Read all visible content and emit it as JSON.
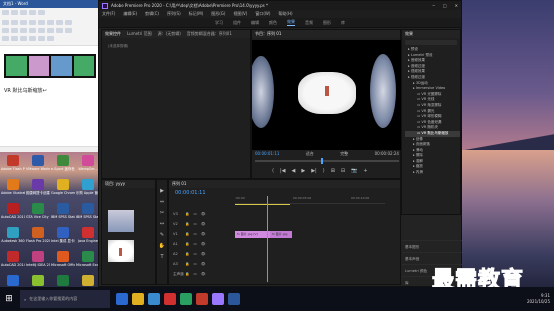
{
  "word": {
    "title": "文档1 - Word",
    "tabs": [
      "文件",
      "开始",
      "插入",
      "页面布局",
      "引用"
    ],
    "doc_text": "VR 默比乌斯缩放↩",
    "status": "第1页"
  },
  "desktop_icons": [
    {
      "label": "Adobe Flash Professio...",
      "color": "#c23a2a"
    },
    {
      "label": "VMware Workstati...",
      "color": "#2f5aa8"
    },
    {
      "label": "e-Sport 迷你世界",
      "color": "#3d8a3d"
    },
    {
      "label": "WampSer...",
      "color": "#d24a9a"
    },
    {
      "label": "Adobe Illustrat...",
      "color": "#e27a1a"
    },
    {
      "label": "韵唐网提卡创建 (v4.2...",
      "color": "#6a3aa8"
    },
    {
      "label": "Google Chrome",
      "color": "#e0b020"
    },
    {
      "label": "乐购 Apple 管理",
      "color": "#30a0d0"
    },
    {
      "label": "AutoCAD 2010",
      "color": "#b82020"
    },
    {
      "label": "GTA Vice City 2010",
      "color": "#2a8a4a"
    },
    {
      "label": "IBM SPSS Statistics 20",
      "color": "#2a5aa0"
    },
    {
      "label": "IBM SPSS Statistics 20",
      "color": "#2a5aa0"
    },
    {
      "label": "Autodesk 360",
      "color": "#30a0c0"
    },
    {
      "label": "Flash Pro 2020 3DS Max",
      "color": "#d06020"
    },
    {
      "label": "Intel 集成 显卡设置",
      "color": "#3060c0"
    },
    {
      "label": "Java Engine",
      "color": "#d03030"
    },
    {
      "label": "AutoCAD 2014",
      "color": "#c02a2a"
    },
    {
      "label": "IntelliJ IDEA 2016",
      "color": "#c04080"
    },
    {
      "label": "Microsoft Office",
      "color": "#e05a20"
    },
    {
      "label": "Microsoft Excel 2010",
      "color": "#2a8a4a"
    },
    {
      "label": "Azure RP 8",
      "color": "#2a6ad0"
    },
    {
      "label": "SVN版本控制",
      "color": "#8ac030"
    },
    {
      "label": "Microsoft Excel 2016",
      "color": "#1e7a3e"
    },
    {
      "label": "python 3.8",
      "color": "#d0b030"
    },
    {
      "label": "Camtasia 9",
      "color": "#2aa060"
    },
    {
      "label": "腾讯QQ",
      "color": "#e03030"
    },
    {
      "label": "Microsoft PowerPo...",
      "color": "#c04020"
    },
    {
      "label": "Fiddler",
      "color": "#3a8ad0"
    }
  ],
  "premiere": {
    "title": "Adobe Premiere Pro 2020 - C:\\用户\\dep\\文档\\Adobe\\Premiere Pro\\14.0\\yyyy.ps *",
    "menus": [
      "文件(F)",
      "编辑(E)",
      "剪辑(C)",
      "序列(S)",
      "标记(M)",
      "图形(G)",
      "视图(V)",
      "窗口(W)",
      "帮助(H)"
    ],
    "workspaces": [
      "学习",
      "组件",
      "编辑",
      "颜色",
      "效果",
      "音频",
      "图形",
      "库"
    ],
    "active_workspace": "效果",
    "source_tabs": [
      "效果控件",
      "Lumetri 范围",
      "源：(无剪辑)",
      "音频剪辑混合器：序列01"
    ],
    "source_sublabel": "(未选择剪辑)",
    "program_tab": "节目：序列 01",
    "program_timecode_left": "00:00:01:11",
    "program_zoom": "适合",
    "program_quality": "完整",
    "program_timecode_right": "00:00:02:24",
    "program_controls": [
      "⟨",
      "|◀",
      "◀",
      "▶",
      "▶|",
      "⟩",
      "⊞",
      "⊟",
      "📷",
      "+"
    ],
    "effects_tab": "效果",
    "effects_tree": [
      {
        "label": "预设",
        "level": 1
      },
      {
        "label": "Lumetri 预设",
        "level": 1
      },
      {
        "label": "音频效果",
        "level": 1
      },
      {
        "label": "音频过渡",
        "level": 1
      },
      {
        "label": "视频效果",
        "level": 1
      },
      {
        "label": "视频过渡",
        "level": 1
      },
      {
        "label": "3D运动",
        "level": 2
      },
      {
        "label": "Immersive Video",
        "level": 2
      },
      {
        "label": "VR 光圈擦除",
        "level": 3
      },
      {
        "label": "VR 光线",
        "level": 3
      },
      {
        "label": "VR 渐变擦除",
        "level": 3
      },
      {
        "label": "VR 漏光",
        "level": 3
      },
      {
        "label": "VR 球形模糊",
        "level": 3
      },
      {
        "label": "VR 色度泄漏",
        "level": 3
      },
      {
        "label": "VR 随机块",
        "level": 3
      },
      {
        "label": "VR 默比乌斯缩放",
        "level": 3
      },
      {
        "label": "划像",
        "level": 2
      },
      {
        "label": "页面剥落",
        "level": 2
      },
      {
        "label": "滑动",
        "level": 2
      },
      {
        "label": "擦除",
        "level": 2
      },
      {
        "label": "溶解",
        "level": 2
      },
      {
        "label": "缩放",
        "level": 2
      },
      {
        "label": "内滑",
        "level": 2
      }
    ],
    "effects_selected": "VR 默比乌斯缩放",
    "effects_footer": [
      "基本图形",
      "基本声音",
      "Lumetri 颜色",
      "库",
      "标记",
      "历史记录",
      "信息"
    ],
    "project_tab": "项目: yyyy",
    "timeline_tab": "序列 01",
    "timeline_timecode": "00:00:01:11",
    "ruler_marks": [
      ":00:00",
      "00:00:05:00",
      "00:00:10:00"
    ],
    "tracks": [
      {
        "name": "V3",
        "type": "video"
      },
      {
        "name": "V2",
        "type": "video"
      },
      {
        "name": "V1",
        "type": "video"
      },
      {
        "name": "A1",
        "type": "audio"
      },
      {
        "name": "A2",
        "type": "audio"
      },
      {
        "name": "A3",
        "type": "audio"
      },
      {
        "name": "主声道",
        "type": "master"
      }
    ],
    "clips": [
      {
        "label": "fx 图片.jpg [V]",
        "track": "V1"
      },
      {
        "label": "fx 图片.jpg",
        "track": "V1"
      }
    ],
    "tools": [
      "▶",
      "⇔",
      "✂",
      "↔",
      "✎",
      "✋",
      "T"
    ]
  },
  "watermark": "最需教育",
  "taskbar": {
    "search_placeholder": "在这里输入你要搜索的内容",
    "time": "9:31",
    "date": "2021/10/25",
    "apps": [
      "#2a6ad0",
      "#e0b020",
      "#3a8ad0",
      "#d03030",
      "#2aa060",
      "#c23a2a",
      "#9a77ff",
      "#2b579a"
    ]
  },
  "colors": {
    "accent": "#4aa3ff",
    "clip": "#d18adf",
    "workarea": "#d8c84a"
  }
}
